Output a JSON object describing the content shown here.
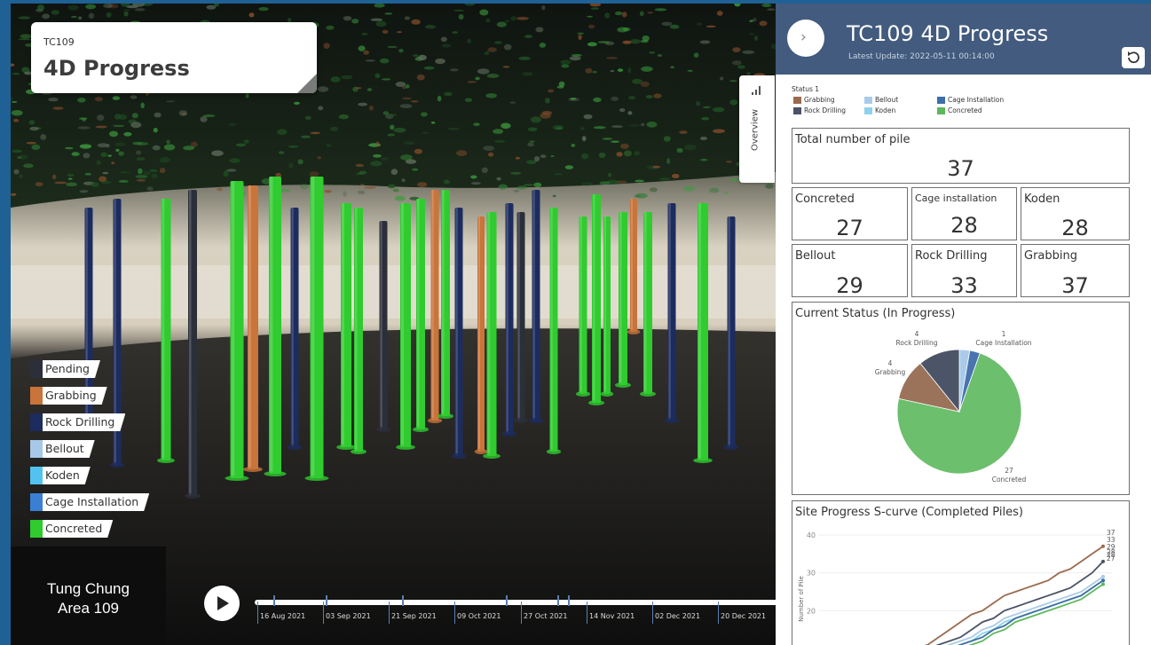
{
  "viewport": {
    "card_sub": "TC109",
    "card_title": "4D Progress",
    "area_line1": "Tung Chung",
    "area_line2": "Area 109",
    "legend": [
      {
        "label": "Pending",
        "color": "#2a2f3a"
      },
      {
        "label": "Grabbing",
        "color": "#c8743a"
      },
      {
        "label": "Rock Drilling",
        "color": "#1d2c5e"
      },
      {
        "label": "Bellout",
        "color": "#a8c8e8"
      },
      {
        "label": "Koden",
        "color": "#52c3f0"
      },
      {
        "label": "Cage Installation",
        "color": "#3b7fd4"
      },
      {
        "label": "Concreted",
        "color": "#2fcb2f"
      }
    ],
    "timeline_labels": [
      "16 Aug 2021",
      "03 Sep 2021",
      "21 Sep 2021",
      "09 Oct 2021",
      "27 Oct 2021",
      "14 Nov 2021",
      "02 Dec 2021",
      "20 Dec 2021"
    ]
  },
  "panel": {
    "title": "TC109 4D Progress",
    "subtitle": "Latest Update: 2022-05-11 00:14:00",
    "side_tab_label": "Overview",
    "status_legend_title": "Status 1",
    "status_legend": [
      {
        "label": "Grabbing",
        "color": "#9b6a4f"
      },
      {
        "label": "Rock Drilling",
        "color": "#4a5366"
      },
      {
        "label": "Bellout",
        "color": "#a9cbe9"
      },
      {
        "label": "Koden",
        "color": "#8dd3ee"
      },
      {
        "label": "Cage Installation",
        "color": "#3e6ea6"
      },
      {
        "label": "Concreted",
        "color": "#5cb85c"
      }
    ],
    "total": {
      "label": "Total number of pile",
      "value": "37"
    },
    "kpis": [
      {
        "label": "Concreted",
        "value": "27"
      },
      {
        "label": "Cage installation",
        "value": "28"
      },
      {
        "label": "Koden",
        "value": "28"
      },
      {
        "label": "Bellout",
        "value": "29"
      },
      {
        "label": "Rock Drilling",
        "value": "33"
      },
      {
        "label": "Grabbing",
        "value": "37"
      }
    ],
    "pie_title": "Current Status (In Progress)",
    "scurve_title": "Site Progress S-curve (Completed Piles)"
  },
  "chart_data": [
    {
      "type": "pie",
      "title": "Current Status (In Progress)",
      "slices": [
        {
          "label": "Concreted",
          "value": 27,
          "color": "#6cbf6c"
        },
        {
          "label": "Grabbing",
          "value": 4,
          "color": "#9b735a"
        },
        {
          "label": "Rock Drilling",
          "value": 4,
          "color": "#4c5468"
        },
        {
          "label": "Bellout",
          "value": 1,
          "color": "#a9cbe9"
        },
        {
          "label": "Cage Installation",
          "value": 1,
          "color": "#4a74b0"
        }
      ],
      "data_labels": [
        {
          "value": "27",
          "label": "Concreted"
        },
        {
          "value": "4",
          "label": "Grabbing"
        },
        {
          "value": "4",
          "label": "Rock Drilling"
        },
        {
          "value": "1",
          "label": "Cage Installation"
        }
      ]
    },
    {
      "type": "line",
      "title": "Site Progress S-curve (Completed Piles)",
      "ylabel": "Number of Pile",
      "ylim": [
        10,
        40
      ],
      "yticks": [
        "40",
        "30",
        "20"
      ],
      "series": [
        {
          "color": "#9b6a4f",
          "end_label": "37",
          "values": [
            10,
            11,
            13,
            15,
            17,
            19,
            20,
            22,
            24,
            25,
            26,
            27,
            28,
            30,
            31,
            33,
            35,
            37
          ]
        },
        {
          "color": "#4a5366",
          "end_label": "33",
          "values": [
            10,
            10,
            11,
            12,
            13,
            15,
            17,
            18,
            20,
            21,
            22,
            23,
            24,
            25,
            26,
            28,
            30,
            33
          ]
        },
        {
          "color": "#a9cbe9",
          "end_label": "29",
          "values": [
            10,
            10,
            10,
            11,
            12,
            13,
            15,
            16,
            18,
            19,
            20,
            21,
            22,
            23,
            24,
            25,
            27,
            29
          ]
        },
        {
          "color": "#8dd3ee",
          "end_label": "28",
          "values": [
            10,
            10,
            10,
            10,
            11,
            12,
            14,
            15,
            17,
            18,
            19,
            20,
            21,
            22,
            23,
            24,
            26,
            28
          ]
        },
        {
          "color": "#3e6ea6",
          "end_label": "28",
          "values": [
            10,
            10,
            10,
            10,
            11,
            12,
            13,
            15,
            16,
            18,
            19,
            20,
            21,
            22,
            23,
            24,
            26,
            28
          ]
        },
        {
          "color": "#5cb85c",
          "end_label": "27",
          "values": [
            10,
            10,
            10,
            10,
            10,
            11,
            12,
            14,
            15,
            17,
            18,
            19,
            20,
            21,
            22,
            23,
            25,
            27
          ]
        }
      ]
    }
  ]
}
